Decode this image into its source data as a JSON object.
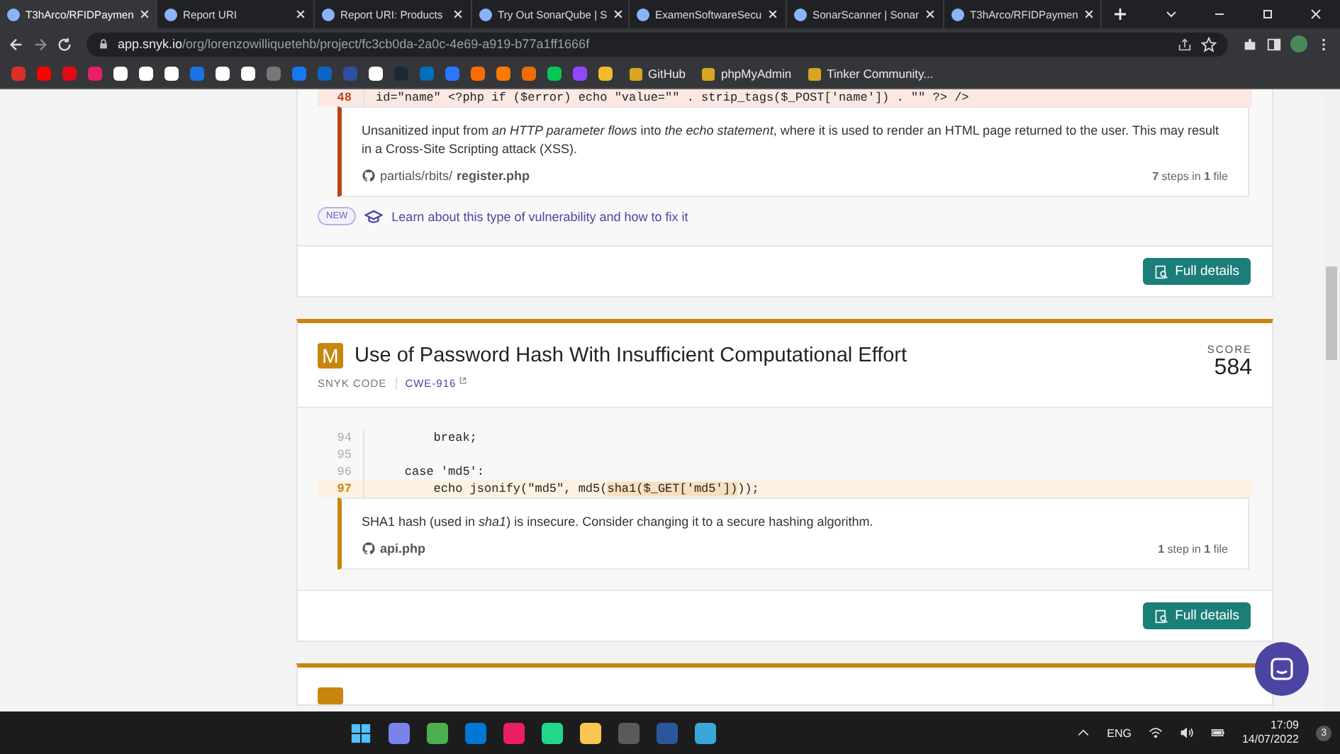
{
  "browser": {
    "tabs": [
      {
        "title": "T3hArco/RFIDPaymen",
        "selected": true
      },
      {
        "title": "Report URI",
        "selected": false
      },
      {
        "title": "Report URI: Products",
        "selected": false
      },
      {
        "title": "Try Out SonarQube | S",
        "selected": false
      },
      {
        "title": "ExamenSoftwareSecu",
        "selected": false
      },
      {
        "title": "SonarScanner | Sonar",
        "selected": false
      },
      {
        "title": "T3hArco/RFIDPaymen",
        "selected": false
      }
    ],
    "address_host": "app.snyk.io",
    "address_path": "/org/lorenzowilliquetehb/project/fc3cb0da-2a0c-4e69-a919-b77a1ff1666f",
    "bookmarks": [
      {
        "label": "GitHub"
      },
      {
        "label": "phpMyAdmin"
      },
      {
        "label": "Tinker Community..."
      }
    ]
  },
  "issues": [
    {
      "color": "#b5461b",
      "code": [
        {
          "number": "48",
          "highlighted": true,
          "segments": [
            {
              "text": "id=\"name\" <?php if ($error) echo \"value=\"\" . strip_tags($_POST['name']) . \"\" ?> />",
              "marked": false
            }
          ]
        }
      ],
      "message": "Unsanitized input from *an HTTP parameter flows* into *the echo statement*, where it is used to render an HTML page returned to the user. This may result in a Cross-Site Scripting attack (XSS).",
      "file": "partials/rbits/**register.php**",
      "steps": "**7** steps in **1** file",
      "learn": {
        "badge": "NEW",
        "text": "Learn about this type of vulnerability and how to fix it"
      },
      "button": "Full details"
    },
    {
      "color": "#c8860f",
      "severity": "M",
      "title": "Use of Password Hash With Insufficient Computational Effort",
      "source": "SNYK CODE",
      "cwe": "CWE-916",
      "score_label": "SCORE",
      "score": "584",
      "code": [
        {
          "number": "94",
          "highlighted": false,
          "segments": [
            {
              "text": "        break;",
              "marked": false
            }
          ]
        },
        {
          "number": "95",
          "highlighted": false
        },
        {
          "number": "96",
          "highlighted": false,
          "segments": [
            {
              "text": "    case 'md5':",
              "marked": false
            }
          ]
        },
        {
          "number": "97",
          "highlighted": true,
          "segments": [
            {
              "text": "        echo jsonify(\"md5\", md5(",
              "marked": false
            },
            {
              "text": "sha1($_GET['md5'])",
              "marked": true
            },
            {
              "text": "));",
              "marked": false
            }
          ]
        }
      ],
      "message": "SHA1 hash (used in *sha1*) is insecure. Consider changing it to a secure hashing algorithm.",
      "file": "**api.php**",
      "steps": "**1** step in **1** file",
      "button": "Full details"
    },
    {
      "color": "#c8860f"
    }
  ],
  "taskbar": {
    "language": "ENG",
    "time": "17:09",
    "date": "14/07/2022",
    "notifications": "3"
  }
}
